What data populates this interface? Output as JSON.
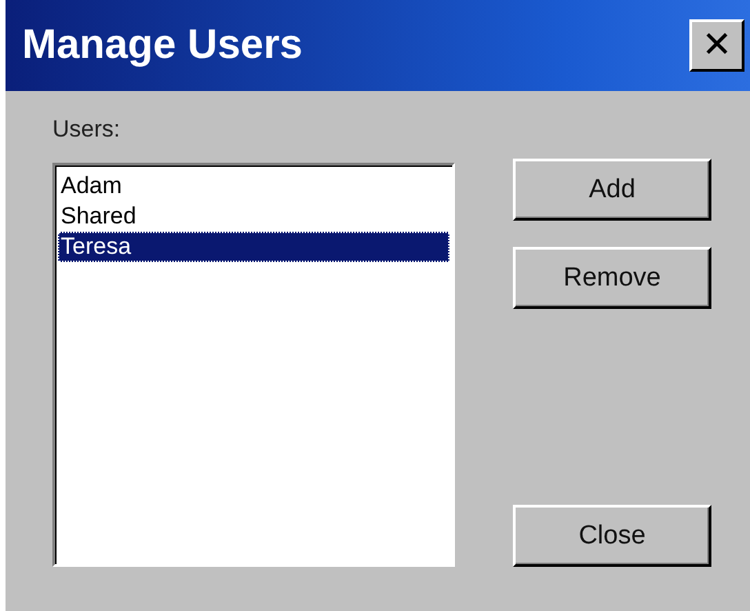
{
  "window": {
    "title": "Manage Users",
    "close": "✕"
  },
  "users_label": "Users:",
  "users": [
    {
      "name": "Adam",
      "selected": false
    },
    {
      "name": "Shared",
      "selected": false
    },
    {
      "name": "Teresa",
      "selected": true
    }
  ],
  "buttons": [
    {
      "label": "Add",
      "kind": "top"
    },
    {
      "label": "Remove",
      "kind": "top"
    },
    {
      "label": "Close",
      "kind": "bottom"
    }
  ]
}
